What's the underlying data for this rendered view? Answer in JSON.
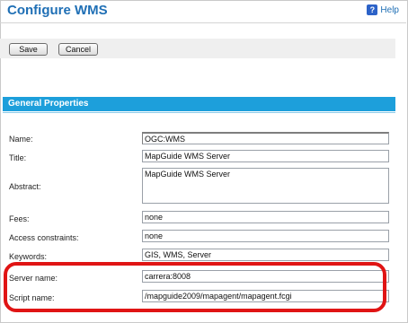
{
  "page": {
    "title": "Configure WMS",
    "help_label": "Help"
  },
  "toolbar": {
    "save_label": "Save",
    "cancel_label": "Cancel"
  },
  "section": {
    "title": "General Properties"
  },
  "fields": {
    "name": {
      "label": "Name:",
      "value": "OGC:WMS"
    },
    "title": {
      "label": "Title:",
      "value": "MapGuide WMS Server"
    },
    "abstract": {
      "label": "Abstract:",
      "value": "MapGuide WMS Server"
    },
    "fees": {
      "label": "Fees:",
      "value": "none"
    },
    "access_constraints": {
      "label": "Access constraints:",
      "value": "none"
    },
    "keywords": {
      "label": "Keywords:",
      "value": "GIS, WMS, Server"
    },
    "server_name": {
      "label": "Server name:",
      "value": "carrera:8008"
    },
    "script_name": {
      "label": "Script name:",
      "value": "/mapguide2009/mapagent/mapagent.fcgi"
    }
  },
  "colors": {
    "title": "#1f6fb5",
    "section_header": "#1d9fdb",
    "highlight": "#e01414"
  }
}
